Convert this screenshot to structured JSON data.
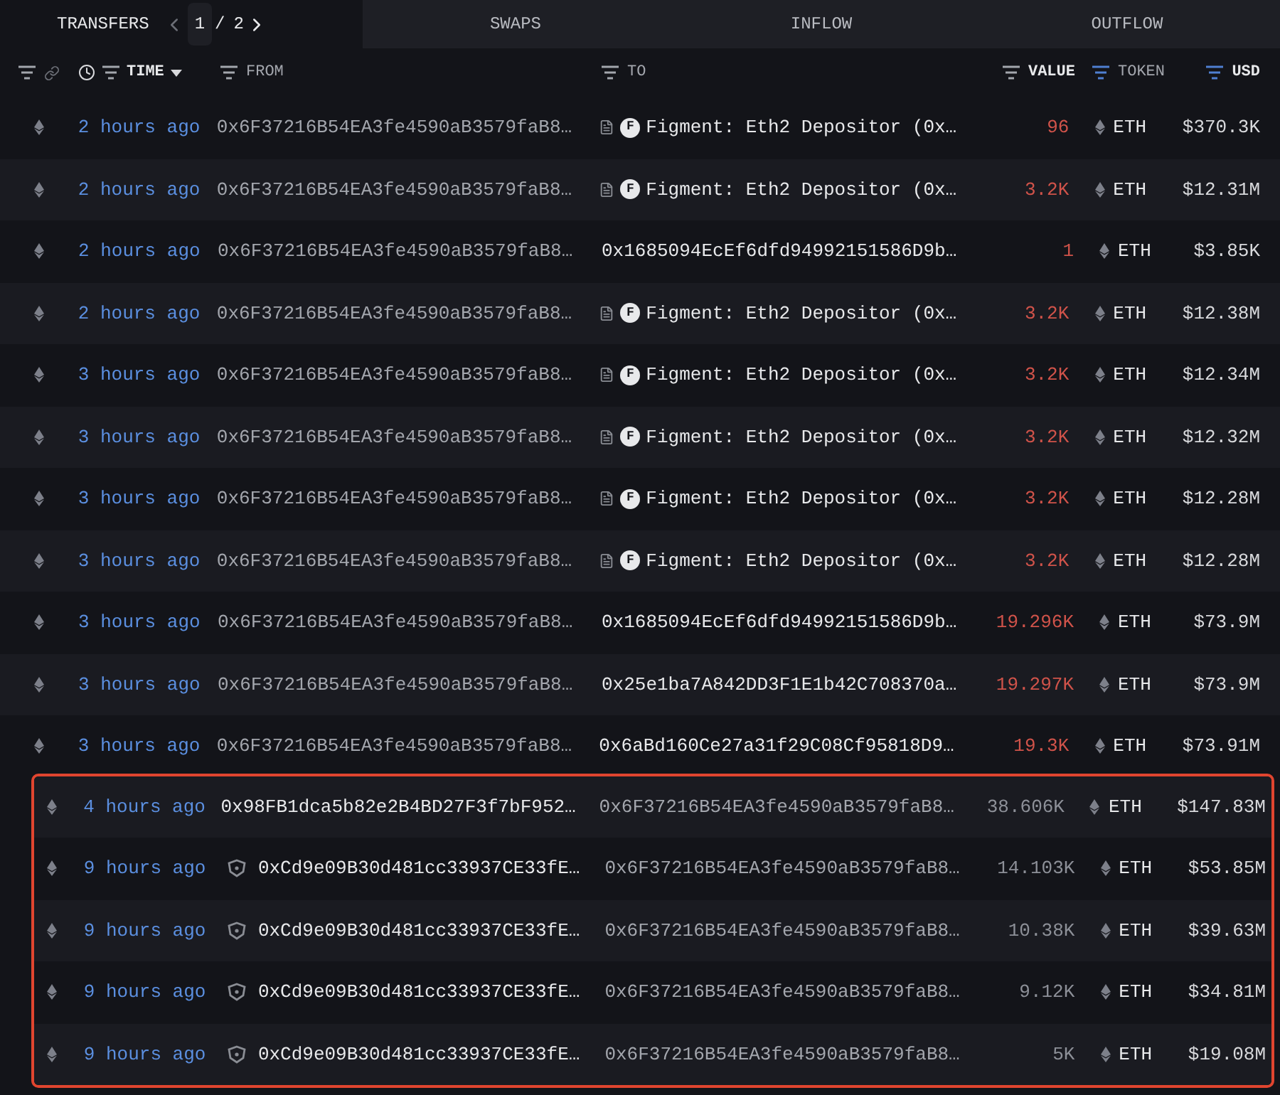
{
  "tabs": [
    {
      "label": "TRANSFERS",
      "selected": true,
      "pager": {
        "current": "1",
        "separator": "/",
        "total": "2"
      }
    },
    {
      "label": "SWAPS",
      "selected": false
    },
    {
      "label": "INFLOW",
      "selected": false
    },
    {
      "label": "OUTFLOW",
      "selected": false
    }
  ],
  "columns": {
    "time": "TIME",
    "from": "FROM",
    "to": "TO",
    "value": "VALUE",
    "token": "TOKEN",
    "usd": "USD"
  },
  "rows": [
    {
      "time": "2 hours ago",
      "from": {
        "address": "0x6F37216B54EA3fe4590aB3579faB8…"
      },
      "to": {
        "address": "Figment: Eth2 Depositor (0x…",
        "entity_badge": "F"
      },
      "value": "96",
      "kind": "outflow",
      "token": "ETH",
      "usd": "$370.3K",
      "highlighted": false
    },
    {
      "time": "2 hours ago",
      "from": {
        "address": "0x6F37216B54EA3fe4590aB3579faB8…"
      },
      "to": {
        "address": "Figment: Eth2 Depositor (0x…",
        "entity_badge": "F"
      },
      "value": "3.2K",
      "kind": "outflow",
      "token": "ETH",
      "usd": "$12.31M",
      "highlighted": false
    },
    {
      "time": "2 hours ago",
      "from": {
        "address": "0x6F37216B54EA3fe4590aB3579faB8…"
      },
      "to": {
        "address": "0x1685094EcEf6dfd94992151586D9b…"
      },
      "value": "1",
      "kind": "outflow",
      "token": "ETH",
      "usd": "$3.85K",
      "highlighted": false
    },
    {
      "time": "2 hours ago",
      "from": {
        "address": "0x6F37216B54EA3fe4590aB3579faB8…"
      },
      "to": {
        "address": "Figment: Eth2 Depositor (0x…",
        "entity_badge": "F"
      },
      "value": "3.2K",
      "kind": "outflow",
      "token": "ETH",
      "usd": "$12.38M",
      "highlighted": false
    },
    {
      "time": "3 hours ago",
      "from": {
        "address": "0x6F37216B54EA3fe4590aB3579faB8…"
      },
      "to": {
        "address": "Figment: Eth2 Depositor (0x…",
        "entity_badge": "F"
      },
      "value": "3.2K",
      "kind": "outflow",
      "token": "ETH",
      "usd": "$12.34M",
      "highlighted": false
    },
    {
      "time": "3 hours ago",
      "from": {
        "address": "0x6F37216B54EA3fe4590aB3579faB8…"
      },
      "to": {
        "address": "Figment: Eth2 Depositor (0x…",
        "entity_badge": "F"
      },
      "value": "3.2K",
      "kind": "outflow",
      "token": "ETH",
      "usd": "$12.32M",
      "highlighted": false
    },
    {
      "time": "3 hours ago",
      "from": {
        "address": "0x6F37216B54EA3fe4590aB3579faB8…"
      },
      "to": {
        "address": "Figment: Eth2 Depositor (0x…",
        "entity_badge": "F"
      },
      "value": "3.2K",
      "kind": "outflow",
      "token": "ETH",
      "usd": "$12.28M",
      "highlighted": false
    },
    {
      "time": "3 hours ago",
      "from": {
        "address": "0x6F37216B54EA3fe4590aB3579faB8…"
      },
      "to": {
        "address": "Figment: Eth2 Depositor (0x…",
        "entity_badge": "F"
      },
      "value": "3.2K",
      "kind": "outflow",
      "token": "ETH",
      "usd": "$12.28M",
      "highlighted": false
    },
    {
      "time": "3 hours ago",
      "from": {
        "address": "0x6F37216B54EA3fe4590aB3579faB8…"
      },
      "to": {
        "address": "0x1685094EcEf6dfd94992151586D9b…"
      },
      "value": "19.296K",
      "kind": "outflow",
      "token": "ETH",
      "usd": "$73.9M",
      "highlighted": false
    },
    {
      "time": "3 hours ago",
      "from": {
        "address": "0x6F37216B54EA3fe4590aB3579faB8…"
      },
      "to": {
        "address": "0x25e1ba7A842DD3F1E1b42C708370a…"
      },
      "value": "19.297K",
      "kind": "outflow",
      "token": "ETH",
      "usd": "$73.9M",
      "highlighted": false
    },
    {
      "time": "3 hours ago",
      "from": {
        "address": "0x6F37216B54EA3fe4590aB3579faB8…"
      },
      "to": {
        "address": "0x6aBd160Ce27a31f29C08Cf95818D9…"
      },
      "value": "19.3K",
      "kind": "outflow",
      "token": "ETH",
      "usd": "$73.91M",
      "highlighted": false
    },
    {
      "time": "4 hours ago",
      "from": {
        "address": "0x98FB1dca5b82e2B4BD27F3f7bF952…"
      },
      "to": {
        "address": "0x6F37216B54EA3fe4590aB3579faB8…"
      },
      "value": "38.606K",
      "kind": "inflow",
      "token": "ETH",
      "usd": "$147.83M",
      "highlighted": true
    },
    {
      "time": "9 hours ago",
      "from": {
        "address": "0xCd9e09B30d481cc33937CE33fE…",
        "unknown_entity": true
      },
      "to": {
        "address": "0x6F37216B54EA3fe4590aB3579faB8…"
      },
      "value": "14.103K",
      "kind": "inflow",
      "token": "ETH",
      "usd": "$53.85M",
      "highlighted": true
    },
    {
      "time": "9 hours ago",
      "from": {
        "address": "0xCd9e09B30d481cc33937CE33fE…",
        "unknown_entity": true
      },
      "to": {
        "address": "0x6F37216B54EA3fe4590aB3579faB8…"
      },
      "value": "10.38K",
      "kind": "inflow",
      "token": "ETH",
      "usd": "$39.63M",
      "highlighted": true
    },
    {
      "time": "9 hours ago",
      "from": {
        "address": "0xCd9e09B30d481cc33937CE33fE…",
        "unknown_entity": true
      },
      "to": {
        "address": "0x6F37216B54EA3fe4590aB3579faB8…"
      },
      "value": "9.12K",
      "kind": "inflow",
      "token": "ETH",
      "usd": "$34.81M",
      "highlighted": true
    },
    {
      "time": "9 hours ago",
      "from": {
        "address": "0xCd9e09B30d481cc33937CE33fE…",
        "unknown_entity": true
      },
      "to": {
        "address": "0x6F37216B54EA3fe4590aB3579faB8…"
      },
      "value": "5K",
      "kind": "inflow",
      "token": "ETH",
      "usd": "$19.08M",
      "highlighted": true
    }
  ]
}
